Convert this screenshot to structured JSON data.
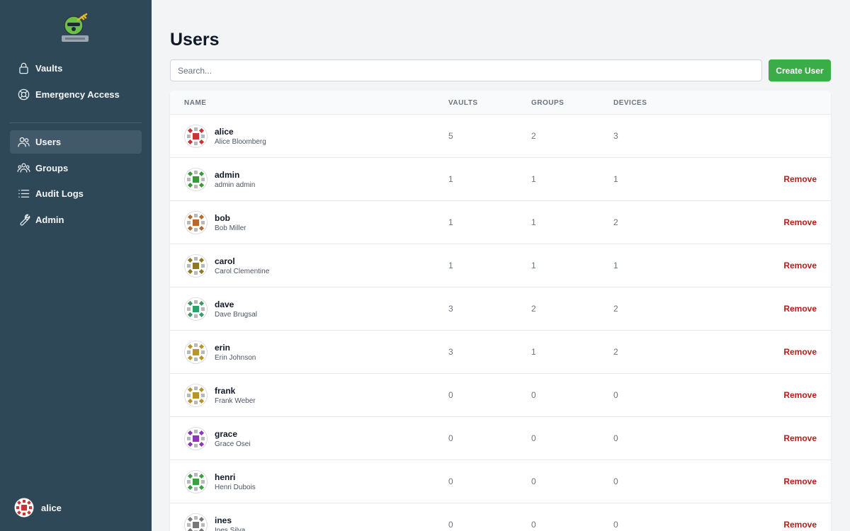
{
  "sidebar": {
    "nav_top": [
      {
        "label": "Vaults",
        "icon": "lock-icon"
      },
      {
        "label": "Emergency Access",
        "icon": "lifebuoy-icon"
      }
    ],
    "nav_bottom": [
      {
        "label": "Users",
        "icon": "users-icon",
        "active": true
      },
      {
        "label": "Groups",
        "icon": "groups-icon"
      },
      {
        "label": "Audit Logs",
        "icon": "list-icon"
      },
      {
        "label": "Admin",
        "icon": "wrench-icon"
      }
    ],
    "profile_name": "alice"
  },
  "page": {
    "title": "Users",
    "search_placeholder": "Search...",
    "create_label": "Create User"
  },
  "table": {
    "headers": {
      "name": "NAME",
      "vaults": "VAULTS",
      "groups": "GROUPS",
      "devices": "DEVICES"
    },
    "remove_label": "Remove",
    "rows": [
      {
        "username": "alice",
        "full_name": "Alice Bloomberg",
        "vaults": "5",
        "groups": "2",
        "devices": "3",
        "removable": false,
        "avatar_color": "#cc3333"
      },
      {
        "username": "admin",
        "full_name": "admin admin",
        "vaults": "1",
        "groups": "1",
        "devices": "1",
        "removable": true,
        "avatar_color": "#3a9a3a"
      },
      {
        "username": "bob",
        "full_name": "Bob Miller",
        "vaults": "1",
        "groups": "1",
        "devices": "2",
        "removable": true,
        "avatar_color": "#b86a2c"
      },
      {
        "username": "carol",
        "full_name": "Carol Clementine",
        "vaults": "1",
        "groups": "1",
        "devices": "1",
        "removable": true,
        "avatar_color": "#8f7a1f"
      },
      {
        "username": "dave",
        "full_name": "Dave Brugsal",
        "vaults": "3",
        "groups": "2",
        "devices": "2",
        "removable": true,
        "avatar_color": "#2aa36a"
      },
      {
        "username": "erin",
        "full_name": "Erin Johnson",
        "vaults": "3",
        "groups": "1",
        "devices": "2",
        "removable": true,
        "avatar_color": "#b8962a"
      },
      {
        "username": "frank",
        "full_name": "Frank Weber",
        "vaults": "0",
        "groups": "0",
        "devices": "0",
        "removable": true,
        "avatar_color": "#b8932a"
      },
      {
        "username": "grace",
        "full_name": "Grace Osei",
        "vaults": "0",
        "groups": "0",
        "devices": "0",
        "removable": true,
        "avatar_color": "#8e35b8"
      },
      {
        "username": "henri",
        "full_name": "Henri Dubois",
        "vaults": "0",
        "groups": "0",
        "devices": "0",
        "removable": true,
        "avatar_color": "#3aa142"
      },
      {
        "username": "ines",
        "full_name": "Ines Silva",
        "vaults": "0",
        "groups": "0",
        "devices": "0",
        "removable": true,
        "avatar_color": "#777777"
      }
    ]
  },
  "colors": {
    "sidebar": "#2f4858",
    "primary_button": "#3aad48",
    "danger": "#b91c1c"
  }
}
